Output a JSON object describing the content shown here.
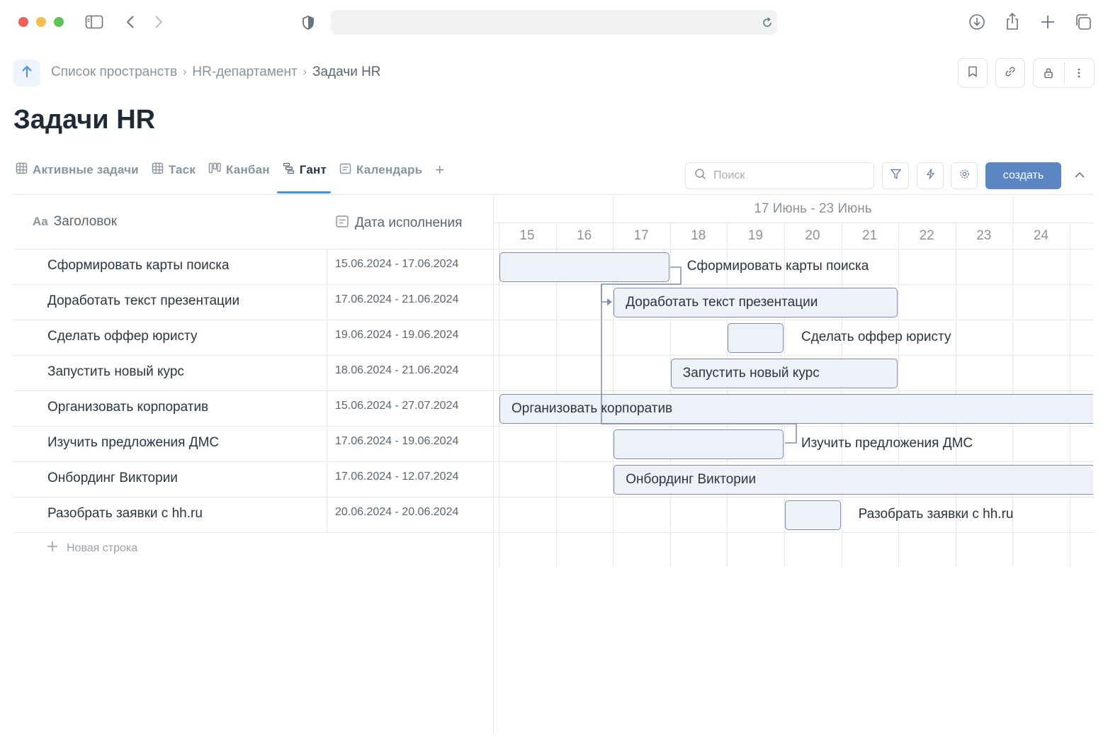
{
  "breadcrumb": {
    "items": [
      "Список пространств",
      "HR-департамент",
      "Задачи HR"
    ],
    "separator": "›"
  },
  "page_title": "Задачи HR",
  "tabs": [
    {
      "label": "Активные задачи",
      "icon": "table-icon"
    },
    {
      "label": "Таск",
      "icon": "table-icon"
    },
    {
      "label": "Канбан",
      "icon": "kanban-icon"
    },
    {
      "label": "Гант",
      "icon": "gantt-icon",
      "active": true
    },
    {
      "label": "Календарь",
      "icon": "calendar-icon"
    }
  ],
  "tab_add": "+",
  "toolbar": {
    "search_placeholder": "Поиск",
    "create_label": "создать"
  },
  "table": {
    "columns": {
      "title": "Заголовок",
      "title_icon": "Aa",
      "due": "Дата исполнения"
    },
    "rows": [
      {
        "title": "Сформировать карты поиска",
        "dates": "15.06.2024 - 17.06.2024"
      },
      {
        "title": "Доработать текст презентации",
        "dates": "17.06.2024 - 21.06.2024"
      },
      {
        "title": "Сделать оффер юристу",
        "dates": "19.06.2024 - 19.06.2024"
      },
      {
        "title": "Запустить новый курс",
        "dates": "18.06.2024 - 21.06.2024"
      },
      {
        "title": "Организовать корпоратив",
        "dates": "15.06.2024 - 27.07.2024"
      },
      {
        "title": "Изучить предложения ДМС",
        "dates": "17.06.2024 - 19.06.2024"
      },
      {
        "title": "Онбординг Виктории",
        "dates": "17.06.2024 - 12.07.2024"
      },
      {
        "title": "Разобрать заявки с hh.ru",
        "dates": "20.06.2024 - 20.06.2024"
      }
    ],
    "new_row_label": "Новая строка"
  },
  "gantt": {
    "week_label": "17 Июнь - 23 Июнь",
    "days": [
      "15",
      "16",
      "17",
      "18",
      "19",
      "20",
      "21",
      "22",
      "23",
      "24"
    ],
    "tasks": [
      {
        "name": "Сформировать карты поиска",
        "start": "15.06.2024",
        "end": "17.06.2024",
        "label_outside": true
      },
      {
        "name": "Доработать текст презентации",
        "start": "17.06.2024",
        "end": "21.06.2024",
        "label_outside": false
      },
      {
        "name": "Сделать оффер юристу",
        "start": "19.06.2024",
        "end": "19.06.2024",
        "label_outside": true
      },
      {
        "name": "Запустить новый курс",
        "start": "18.06.2024",
        "end": "21.06.2024",
        "label_outside": false
      },
      {
        "name": "Организовать корпоратив",
        "start": "15.06.2024",
        "end": "27.07.2024",
        "label_outside": false
      },
      {
        "name": "Изучить предложения ДМС",
        "start": "17.06.2024",
        "end": "19.06.2024",
        "label_outside": true
      },
      {
        "name": "Онбординг Виктории",
        "start": "17.06.2024",
        "end": "12.07.2024",
        "label_outside": false
      },
      {
        "name": "Разобрать заявки с hh.ru",
        "start": "20.06.2024",
        "end": "20.06.2024",
        "label_outside": true
      }
    ]
  },
  "colors": {
    "accent": "#4b8fd1",
    "create_button": "#5b86c4",
    "bar_fill": "#eef1f8",
    "bar_border": "#7f8ea6"
  }
}
